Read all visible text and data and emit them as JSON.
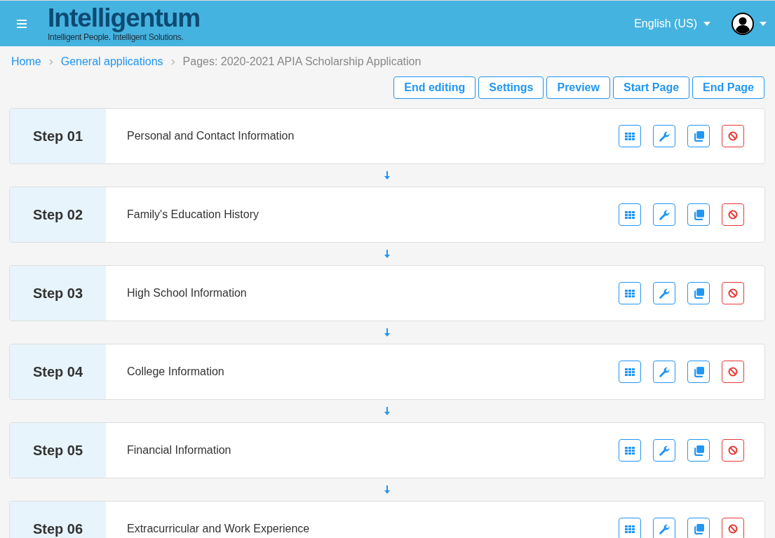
{
  "header": {
    "logo": "Intelligentum",
    "tagline": "Intelligent People. Intelligent Solutions.",
    "language": "English (US)"
  },
  "breadcrumb": [
    {
      "label": "Home",
      "link": true
    },
    {
      "label": "General applications",
      "link": true
    },
    {
      "label": "Pages: 2020-2021 APIA Scholarship Application",
      "link": false
    }
  ],
  "toolbar": [
    "End editing",
    "Settings",
    "Preview",
    "Start Page",
    "End Page"
  ],
  "steps": [
    {
      "step": "Step 01",
      "title": "Personal and Contact Information"
    },
    {
      "step": "Step 02",
      "title": "Family's Education History"
    },
    {
      "step": "Step 03",
      "title": "High School Information"
    },
    {
      "step": "Step 04",
      "title": "College Information"
    },
    {
      "step": "Step 05",
      "title": "Financial Information"
    },
    {
      "step": "Step 06",
      "title": "Extracurricular and Work Experience"
    }
  ]
}
